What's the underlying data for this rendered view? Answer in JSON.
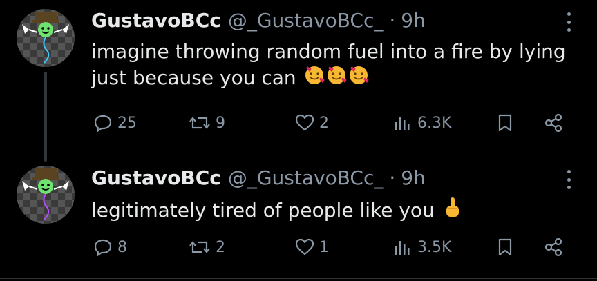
{
  "tweets": [
    {
      "display_name": "GustavoBCc",
      "handle": "@_GustavoBCc_",
      "separator": "·",
      "time": "9h",
      "text": "imagine throwing random fuel into a fire by lying just because you can",
      "emojis": [
        "smiling-face-with-hearts",
        "smiling-face-with-hearts",
        "smiling-face-with-hearts"
      ],
      "replies": "25",
      "reposts": "9",
      "likes": "2",
      "views": "6.3K"
    },
    {
      "display_name": "GustavoBCc",
      "handle": "@_GustavoBCc_",
      "separator": "·",
      "time": "9h",
      "text": "legitimately tired of people like you",
      "emojis": [
        "middle-finger"
      ],
      "replies": "8",
      "reposts": "2",
      "likes": "1",
      "views": "3.5K"
    }
  ],
  "colors": {
    "background": "#000000",
    "primary_text": "#e7e9ea",
    "secondary_text": "#8b98a5",
    "divider": "#2f3336"
  }
}
